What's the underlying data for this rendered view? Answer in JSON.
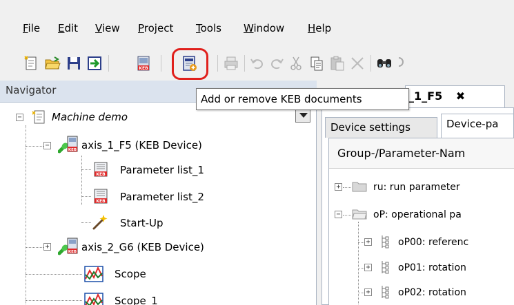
{
  "menubar": {
    "items": [
      {
        "accel": "F",
        "rest": "ile"
      },
      {
        "accel": "E",
        "rest": "dit"
      },
      {
        "accel": "V",
        "rest": "iew"
      },
      {
        "accel": "P",
        "rest": "roject"
      },
      {
        "accel": "T",
        "rest": "ools"
      },
      {
        "accel": "W",
        "rest": "indow"
      },
      {
        "accel": "H",
        "rest": "elp"
      }
    ]
  },
  "toolbar": {
    "highlight_color": "#e0201c",
    "icons": [
      "new-project-icon",
      "open-folder-icon",
      "save-icon",
      "import-icon",
      "keb-book-icon",
      "keb-documents-icon",
      "print-icon",
      "undo-icon",
      "redo-icon",
      "cut-icon",
      "copy-icon",
      "paste-icon",
      "delete-icon",
      "find-icon",
      "find-next-icon"
    ]
  },
  "tooltip": {
    "text": "Add or remove KEB documents"
  },
  "navigator": {
    "title": "Navigator",
    "tree": {
      "root": {
        "label": "Machine demo"
      },
      "axis1": {
        "label": "axis_1_F5 (KEB Device)"
      },
      "param1": {
        "label": "Parameter list_1"
      },
      "param2": {
        "label": "Parameter list_2"
      },
      "startup": {
        "label": "Start-Up"
      },
      "axis2": {
        "label": "axis_2_G6 (KEB Device)"
      },
      "scope": {
        "label": "Scope"
      },
      "scope1": {
        "label": "Scope_1"
      }
    }
  },
  "editor": {
    "doc_tab": {
      "label": "_1_F5",
      "close": "✖"
    },
    "sub_tabs": {
      "device_settings": "Device settings",
      "device_params": "Device-pa"
    },
    "grid": {
      "header": "Group-/Parameter-Nam",
      "rows": [
        {
          "label": "ru: run parameter"
        },
        {
          "label": "oP: operational pa"
        },
        {
          "label": "oP00: referenc"
        },
        {
          "label": "oP01: rotation"
        },
        {
          "label": "oP02: rotation"
        }
      ]
    }
  }
}
